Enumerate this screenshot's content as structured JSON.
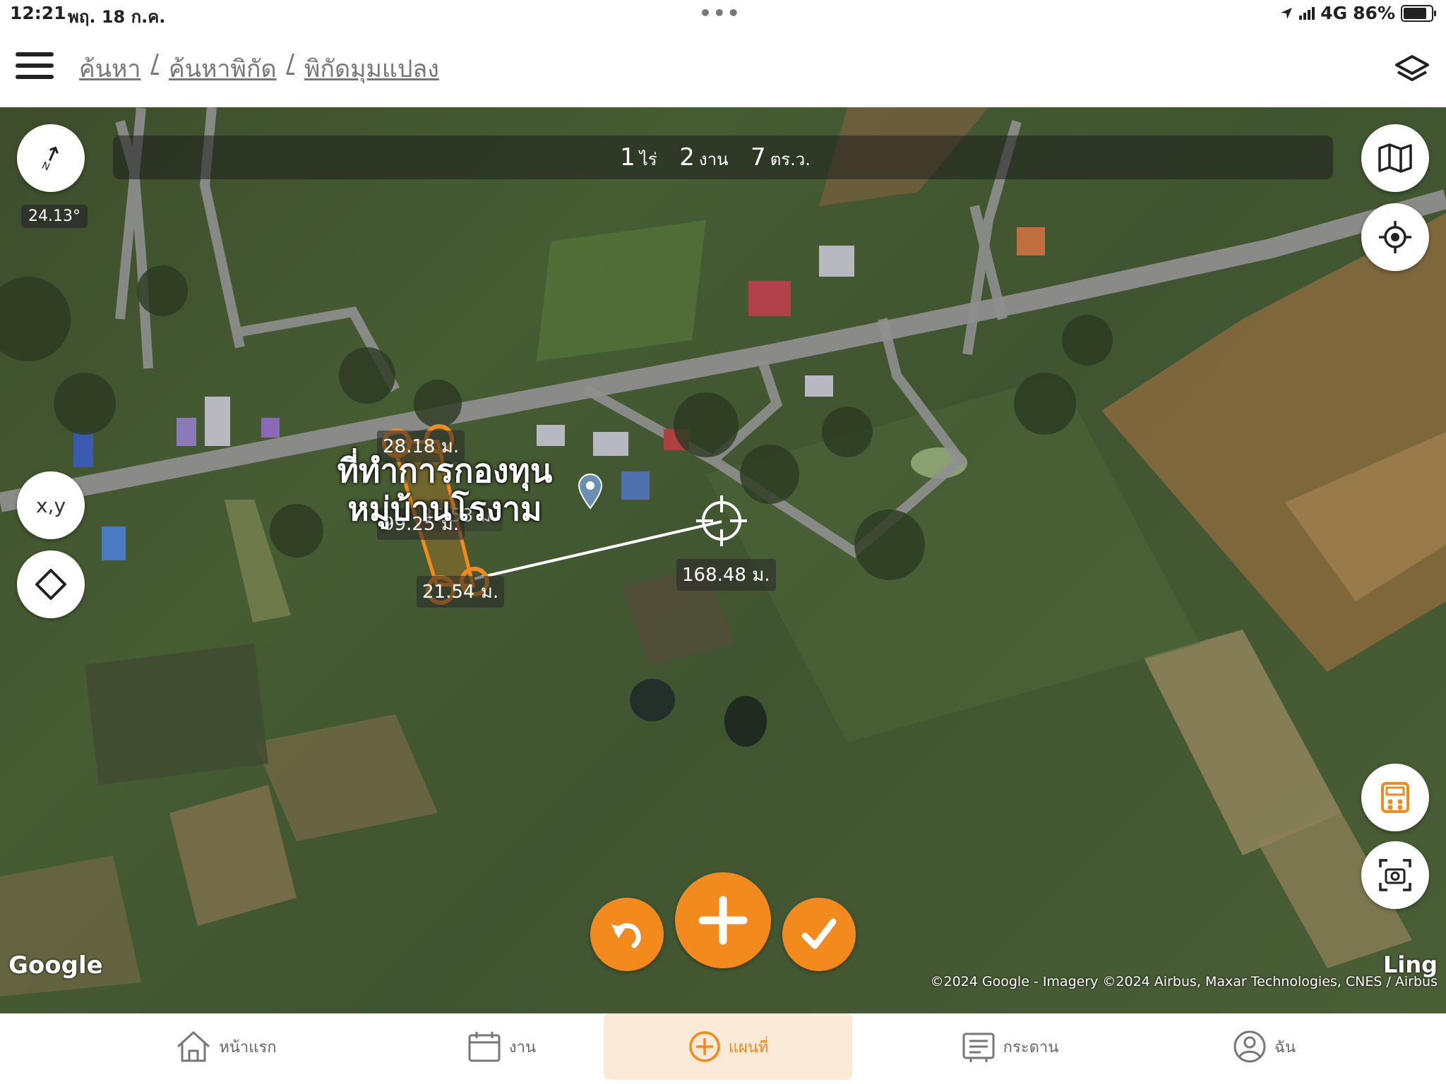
{
  "status": {
    "time": "12:21",
    "date": "พฤ. 18 ก.ค.",
    "network": "4G",
    "battery": "86%"
  },
  "breadcrumb": {
    "level1": "ค้นหา",
    "sep": "/",
    "level2": "ค้นหาพิกัด",
    "level3": "พิกัดมุมแปลง"
  },
  "area": {
    "rai": "1",
    "rai_unit": "ไร่",
    "ngan": "2",
    "ngan_unit": "งาน",
    "wa": "7",
    "wa_unit": "ตร.ว."
  },
  "map": {
    "rotation": "24.13°",
    "xy_label": "x,y",
    "place_name_line1": "ที่ทำการกองทุน",
    "place_name_line2": "หมู่บ้านโรงาม",
    "edge_labels": [
      "28.18 ม.",
      "99.25 ม.",
      "36.53 ม.",
      "21.54 ม."
    ],
    "cursor_distance": "168.48 ม.",
    "google": "Google",
    "copyright": "©2024 Google - Imagery ©2024 Airbus, Maxar Technologies, CNES / Airbus",
    "ling": "Ling"
  },
  "colors": {
    "accent": "#f28a1e"
  },
  "tabs": [
    {
      "label": "หน้าแรก",
      "icon": "home-icon"
    },
    {
      "label": "งาน",
      "icon": "calendar-icon"
    },
    {
      "label": "แผนที่",
      "icon": "plus-circle-icon",
      "active": true
    },
    {
      "label": "กระดาน",
      "icon": "board-icon"
    },
    {
      "label": "ฉัน",
      "icon": "user-icon"
    }
  ]
}
